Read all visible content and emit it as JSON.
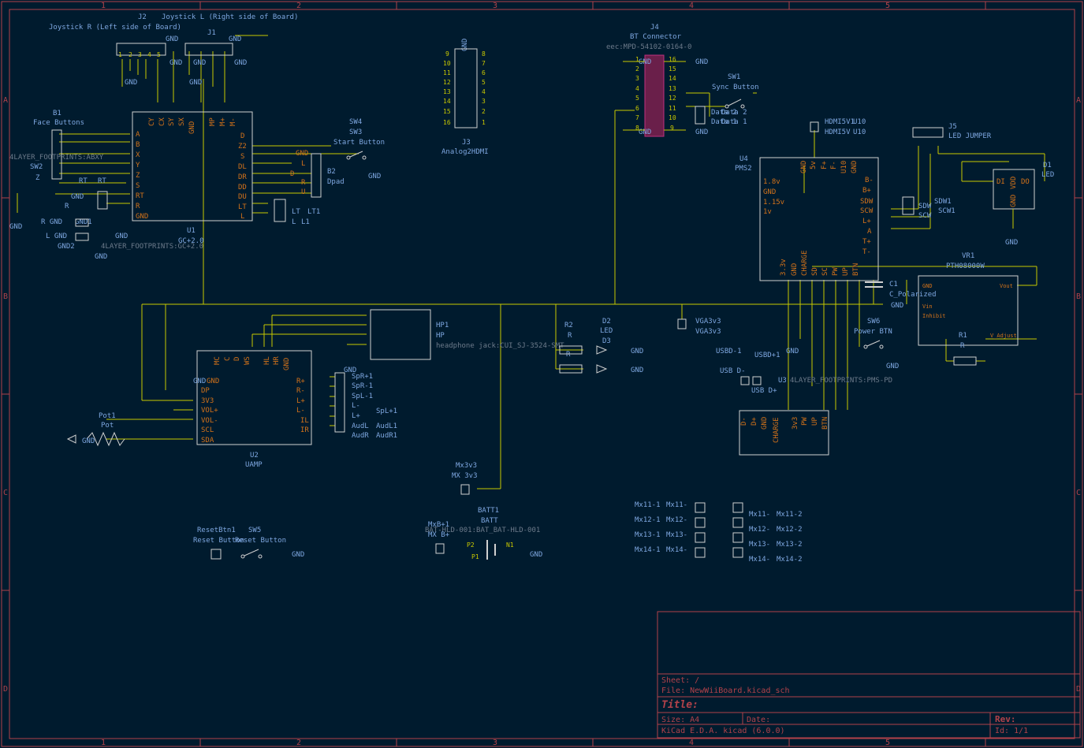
{
  "sheet": {
    "column_markers": [
      "1",
      "2",
      "3",
      "4",
      "5"
    ],
    "row_markers": [
      "A",
      "B",
      "C",
      "D",
      "E"
    ]
  },
  "title_block": {
    "sheet": "Sheet: /",
    "file": "File: NewWiiBoard.kicad_sch",
    "title": "Title:",
    "size": "Size: A4",
    "date": "Date:",
    "rev": "Rev:",
    "tool": "KiCad E.D.A.  kicad (6.0.0)",
    "id": "Id: 1/1"
  },
  "components": {
    "j2": {
      "ref": "J2",
      "value": "Joystick R (Left side of Board)"
    },
    "j1": {
      "ref": "J1",
      "value": "Joystick L (Right side of Board)"
    },
    "b1": {
      "ref": "B1",
      "value": "Face Buttons",
      "footprint": "4LAYER_FOOTPRINTS:ABXY"
    },
    "sw2": {
      "ref": "SW2",
      "value": "Z"
    },
    "u1": {
      "ref": "U1",
      "value": "GC+2.0",
      "footprint": "4LAYER_FOOTPRINTS:GC+2.0",
      "left_pins": [
        "A",
        "B",
        "X",
        "Y",
        "Z",
        "S",
        "RT",
        "R",
        "GND"
      ],
      "right_pins": [
        "D",
        "Z2",
        "S",
        "DL",
        "DR",
        "DD",
        "DU",
        "LT",
        "L"
      ],
      "top_pins": [
        "CY",
        "CX",
        "SY",
        "SX",
        "GND",
        "MP",
        "M+",
        "M-"
      ]
    },
    "rt": {
      "ref": "RT",
      "value": "RT"
    },
    "r_gnd": {
      "label1": "R GND",
      "label2": "GND1",
      "label3": "R"
    },
    "l_gnd": {
      "label1": "L GND",
      "label2": "GND2"
    },
    "sw3": {
      "ref": "SW3",
      "ref2": "SW4",
      "value": "Start Button"
    },
    "b2": {
      "ref": "B2",
      "value": "Dpad",
      "pins": [
        "GND",
        "L",
        "D",
        "R",
        "U"
      ]
    },
    "lt": {
      "ref": "LT",
      "ref2": "LT1",
      "value": "L",
      "value2": "L1"
    },
    "j3": {
      "ref": "J3",
      "value": "Analog2HDMI",
      "left": [
        "9",
        "10",
        "11",
        "12",
        "13",
        "14",
        "15",
        "16"
      ],
      "right": [
        "8",
        "7",
        "6",
        "5",
        "4",
        "3",
        "2",
        "1"
      ]
    },
    "j4": {
      "ref": "J4",
      "value": "BT Connector",
      "footprint": "eec:MPD-54102-0164-0",
      "left": [
        "1",
        "2",
        "3",
        "4",
        "5",
        "6",
        "7",
        "8"
      ],
      "right": [
        "16",
        "15",
        "14",
        "13",
        "12",
        "11",
        "10",
        "9"
      ]
    },
    "sw1": {
      "ref": "SW1",
      "value": "Sync Button"
    },
    "data": {
      "d1": "Data 2",
      "d2": "Data 1",
      "d3": "Data 2",
      "d4": "Data 1"
    },
    "hdmi": {
      "ref": "HDMI5V1",
      "ref2": "U10",
      "value": "HDMI5V",
      "value2": "U10"
    },
    "j5": {
      "ref": "J5",
      "value": "LED JUMPER"
    },
    "d1": {
      "ref": "D1",
      "value": "LED",
      "pins": [
        "DI",
        "DO",
        "VDD",
        "GND"
      ]
    },
    "u4": {
      "ref": "U4",
      "value": "PMS2",
      "left": [
        "1.8v",
        "GND",
        "1.15v",
        "1v"
      ],
      "right": [
        "B-",
        "B+",
        "SDW",
        "SCW",
        "L+",
        "A",
        "T+",
        "T-"
      ],
      "top": [
        "GND",
        "5v",
        "F+",
        "F-",
        "U10",
        "GND"
      ],
      "bottom": [
        "3.3v",
        "GND",
        "CHARGE",
        "SD",
        "SC",
        "PW",
        "UP",
        "BTN"
      ]
    },
    "sdw": {
      "ref": "SDW1",
      "value": "SCW1",
      "l1": "SDW",
      "l2": "SCW"
    },
    "vr1": {
      "ref": "VR1",
      "value": "PTH08000W",
      "pins": [
        "GND",
        "Vin",
        "Inhibit",
        "Vout",
        "V_Adjust"
      ]
    },
    "c1": {
      "ref": "C1",
      "value": "C_Polarized"
    },
    "r1": {
      "ref": "R1",
      "value": "R"
    },
    "sw6": {
      "ref": "SW6",
      "value": "Power BTN"
    },
    "u3": {
      "ref": "U3",
      "value": "PMS-PD",
      "footprint": "4LAYER_FOOTPRINTS:PMS-PD",
      "pins": [
        "D-",
        "D+",
        "GND",
        "CHARGE",
        "3v3",
        "PW",
        "UP",
        "BTN"
      ]
    },
    "usb": {
      "dm": "USB D-",
      "dm1": "USBD-1",
      "dp": "USB D+",
      "dp1": "USBD+1"
    },
    "hp": {
      "ref": "HP1",
      "value": "HP",
      "footprint": "headphone jack:CUI_SJ-3524-SMT"
    },
    "r2": {
      "ref": "R2",
      "value": "R",
      "ref2": "R3",
      "value2": "R"
    },
    "d2": {
      "ref": "D2",
      "value": "LED",
      "ref2": "D3",
      "value2": "LED"
    },
    "vga": {
      "ref": "VGA3v3",
      "value": "VGA3v3"
    },
    "u2": {
      "ref": "U2",
      "value": "UAMP",
      "left": [
        "GND",
        "DP",
        "3V3",
        "VOL+",
        "VOL-",
        "SCL",
        "SDA"
      ],
      "right": [
        "R+",
        "R-",
        "L+",
        "L-",
        "IL",
        "IR"
      ],
      "top": [
        "MC",
        "C",
        "D",
        "WS",
        "HL",
        "HR",
        "GND"
      ]
    },
    "spk": {
      "l1": "SpR+1",
      "l2": "SpR-1",
      "l3": "SpL-1",
      "l4": "SpL+1",
      "l5": "R+",
      "l6": "R-",
      "l7": "L-",
      "l8": "L+",
      "l9": "AudL",
      "l10": "AudR",
      "l11": "AudL1",
      "l12": "AudR1"
    },
    "pot": {
      "ref": "Pot1",
      "value": "Pot"
    },
    "mx": {
      "ref": "Mx3v3",
      "value": "MX 3v3"
    },
    "batt": {
      "ref": "BATT1",
      "value": "BATT",
      "footprint": "BAT-HLD-001:BAT_BAT-HLD-001",
      "p1": "P1",
      "p2": "P2",
      "n1": "N1",
      "mxb": "MxB+1",
      "mxb2": "MX B+"
    },
    "reset": {
      "ref": "ResetBtn1",
      "value": "Reset Button",
      "ref2": "SW5",
      "value2": "Reset Button"
    },
    "mx_left": [
      "Mx11-1",
      "Mx12-1",
      "Mx13-1",
      "Mx14-1"
    ],
    "mx_left2": [
      "Mx11-",
      "Mx12-",
      "Mx13-",
      "Mx14-"
    ],
    "mx_right": [
      "Mx11-2",
      "Mx12-2",
      "Mx13-2",
      "Mx14-2"
    ],
    "mx_right2": [
      "Mx11-",
      "Mx12-",
      "Mx13-",
      "Mx14-"
    ]
  },
  "labels": {
    "gnd": "GND",
    "pin1": "1",
    "pin2": "2",
    "pin3": "3",
    "pin4": "4",
    "pin5": "5"
  }
}
